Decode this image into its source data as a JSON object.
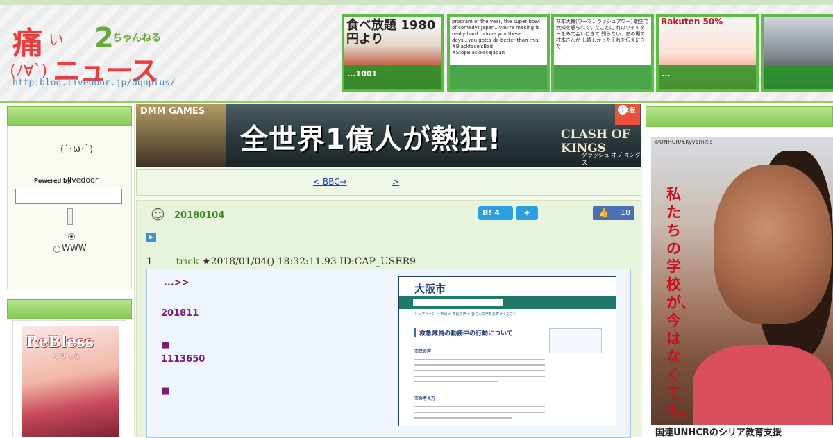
{
  "header": {
    "logo_kanji": "痛",
    "logo_i": "い",
    "logo_two": "2",
    "logo_chan": "ちゃんねる",
    "logo_face": "(ﾉ∀`)",
    "logo_news": "ニュース",
    "logo_url": "http:blog.livedoor.jp/dqnplus/",
    "thumbnails": [
      {
        "caption": "...1001",
        "text": "食べ放題 1980円より"
      },
      {
        "caption": "",
        "text": "program of the year, the super bowl of comedy! Japan...you're making it really hard to love you these days...you gotta do better than this! #BlackfaceIsBad #StopBlackFaceJapan"
      },
      {
        "caption": "",
        "text": "林本大輔(ウーマンラッシュアワー) 朝生で無知を怒られていたことに れのツイッターをみて会いにきて 知らない、あの場で村本さんが し嬉しかったそれを伝えにきた"
      },
      {
        "caption": "...",
        "text": "Rakuten 50%"
      },
      {
        "caption": "",
        "text": ""
      }
    ]
  },
  "sidebar": {
    "face": "(´･ω･`)",
    "powered_by": "Powered by",
    "livedoor": "livedoor",
    "search_value": "",
    "radio_www_label": "WWW",
    "ad_title": "ReBless",
    "ad_sub": "リブレス"
  },
  "main": {
    "banner": {
      "brand": "DMM GAMES",
      "headline": "全世界1億人が熱狂!",
      "game": "CLASH OF KINGS",
      "game_sub": "クラッシュ オブ キングス",
      "ad_badge": "AC版"
    },
    "nav": {
      "prev": "< BBC→",
      "next": ">"
    },
    "post": {
      "date": "20180104",
      "hatena": "B! 4",
      "likes": "18",
      "number": "1",
      "name": "trick",
      "meta": "★2018/01/04() 18:32:11.93 ID:CAP_USER9",
      "quote_lines": [
        "...>>",
        "201811",
        "■",
        "1113650",
        "■"
      ],
      "image": {
        "logo": "大阪市",
        "breadcrumb": "トップページ > 市政 > 市民の声 > 皆さんの声をお寄せください",
        "title": "救急隊員の勤務中の行動について",
        "section1": "市民の声",
        "section2": "市の考え方"
      }
    }
  },
  "right": {
    "credit": "©UNHCR/Y.Kyvernitis",
    "headline": "私たちの学校が、今はなくても。",
    "bottom": "国連UNHCRのシリア教育支援"
  }
}
